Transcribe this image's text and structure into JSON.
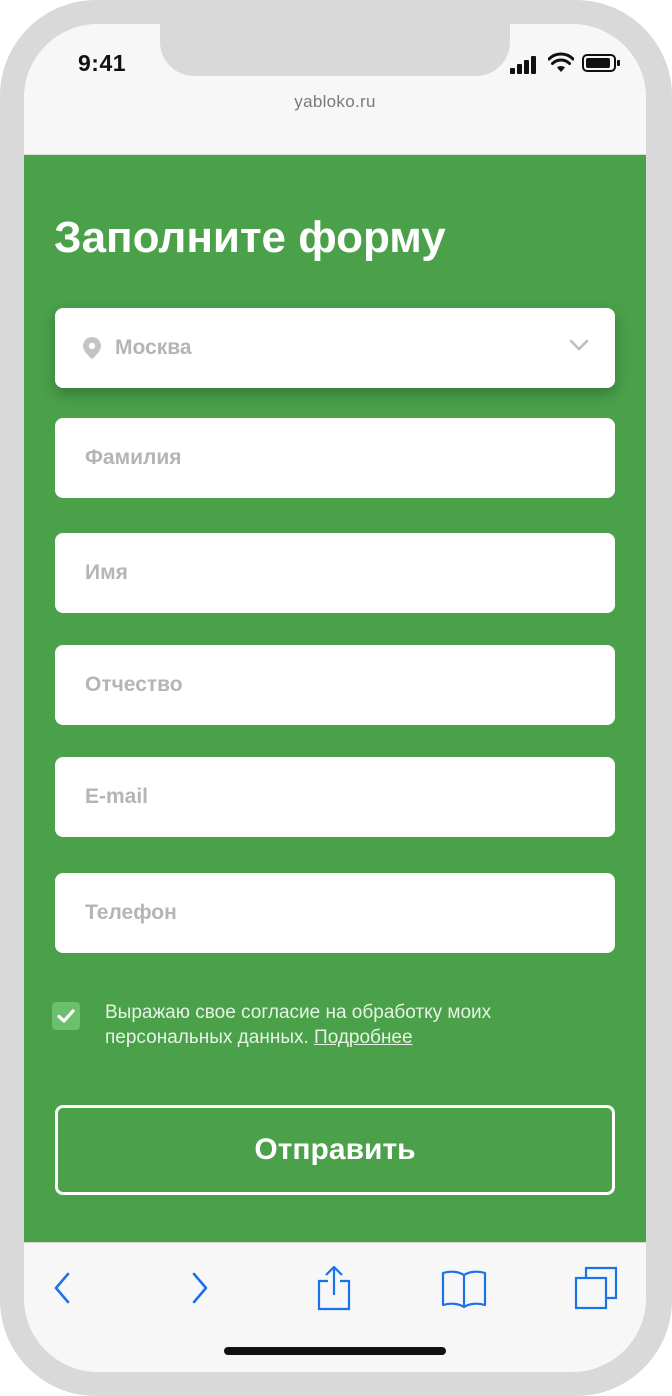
{
  "status": {
    "time": "9:41"
  },
  "browser": {
    "url": "yabloko.ru"
  },
  "form": {
    "title": "Заполните форму",
    "city": "Москва",
    "fields": [
      {
        "name": "surname",
        "placeholder": "Фамилия"
      },
      {
        "name": "first-name",
        "placeholder": "Имя"
      },
      {
        "name": "patronymic",
        "placeholder": "Отчество"
      },
      {
        "name": "email",
        "placeholder": "E-mail"
      },
      {
        "name": "phone",
        "placeholder": "Телефон"
      }
    ],
    "consent_text": "Выражаю свое согласие на обработку моих персональных данных.",
    "consent_link": "Подробнее",
    "consent_checked": true,
    "submit_label": "Отправить"
  },
  "toolbar": {
    "icons": [
      "back-icon",
      "forward-icon",
      "share-icon",
      "bookmarks-icon",
      "tabs-icon"
    ]
  },
  "colors": {
    "accent_green": "#4aa14a",
    "toolbar_blue": "#1a73e8"
  }
}
